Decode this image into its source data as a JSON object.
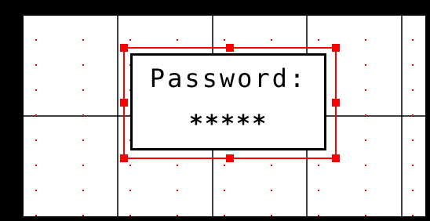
{
  "app": {
    "background_color": "#000000",
    "canvas_color": "#ffffff",
    "grid_line_color": "#000000",
    "dot_color": "#ff0000",
    "selection_color": "#ff0000"
  },
  "widget": {
    "type": "password-entry",
    "label": "Password:",
    "masked_value": "*****",
    "selected": true
  }
}
